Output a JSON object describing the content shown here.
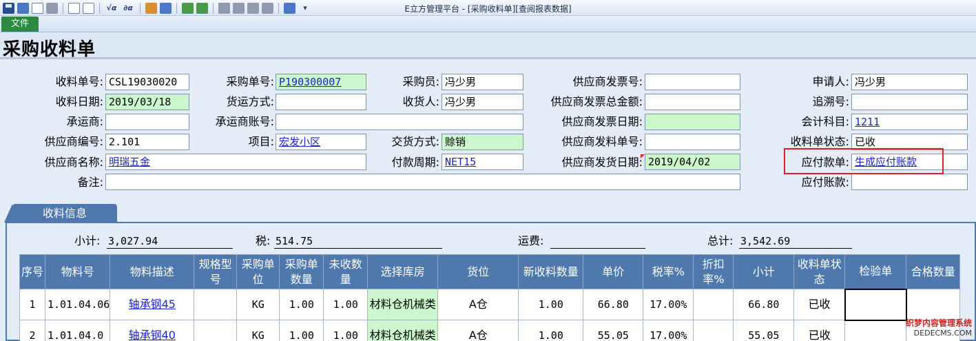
{
  "window": {
    "title": "E立方管理平台 - [采购收料单][查阅报表数据]"
  },
  "ribbon": {
    "file_label": "文件"
  },
  "page": {
    "title": "采购收料单"
  },
  "form": {
    "receipt_no": {
      "label": "收料单号:",
      "value": "CSL19030020"
    },
    "receipt_date": {
      "label": "收料日期:",
      "value": "2019/03/18"
    },
    "carrier": {
      "label": "承运商:",
      "value": ""
    },
    "supplier_code": {
      "label": "供应商编号:",
      "value": "2.101"
    },
    "supplier_name": {
      "label": "供应商名称:",
      "value": "明瑞五金"
    },
    "remark": {
      "label": "备注:",
      "value": ""
    },
    "po_no": {
      "label": "采购单号:",
      "value": "P190300007"
    },
    "ship_method": {
      "label": "货运方式:",
      "value": ""
    },
    "carrier_account": {
      "label": "承运商账号:",
      "value": ""
    },
    "project": {
      "label": "项目:",
      "value": "宏发小区"
    },
    "buyer": {
      "label": "采购员:",
      "value": "冯少男"
    },
    "receiver": {
      "label": "收货人:",
      "value": "冯少男"
    },
    "delivery_method": {
      "label": "交货方式:",
      "value": "赊销"
    },
    "payment_term": {
      "label": "付款周期:",
      "value": "NET15"
    },
    "supplier_invoice_no": {
      "label": "供应商发票号:",
      "value": ""
    },
    "supplier_invoice_total": {
      "label": "供应商发票总金额:",
      "value": ""
    },
    "supplier_invoice_date": {
      "label": "供应商发票日期:",
      "value": ""
    },
    "supplier_ship_no": {
      "label": "供应商发料单号:",
      "value": ""
    },
    "supplier_ship_date": {
      "label": "供应商发货日期:",
      "value": "2019/04/02"
    },
    "applicant": {
      "label": "申请人:",
      "value": "冯少男"
    },
    "trace_no": {
      "label": "追溯号:",
      "value": ""
    },
    "account_subject": {
      "label": "会计科目:",
      "value": "1211"
    },
    "receipt_status": {
      "label": "收料单状态:",
      "value": "已收"
    },
    "payable_doc": {
      "label": "应付款单:",
      "value": "生成应付账款"
    },
    "payable": {
      "label": "应付账款:",
      "value": ""
    }
  },
  "tab": {
    "label": "收料信息"
  },
  "totals": {
    "subtotal": {
      "label": "小计:",
      "value": "3,027.94"
    },
    "tax": {
      "label": "税:",
      "value": "514.75"
    },
    "freight": {
      "label": "运费:",
      "value": ""
    },
    "total": {
      "label": "总计:",
      "value": "3,542.69"
    }
  },
  "grid": {
    "headers": [
      "序号",
      "物料号",
      "物料描述",
      "规格型号",
      "采购单位",
      "采购单数量",
      "未收数量",
      "选择库房",
      "货位",
      "新收料数量",
      "单价",
      "税率%",
      "折扣率%",
      "小计",
      "收料单状态",
      "检验单",
      "合格数量"
    ],
    "rows": [
      [
        "1",
        "1.01.04.06",
        "轴承钢45",
        "",
        "KG",
        "1.00",
        "1.00",
        "材料仓机械类",
        "A仓",
        "1.00",
        "66.80",
        "17.00%",
        "",
        "66.80",
        "已收",
        "",
        ""
      ],
      [
        "2",
        "1.01.04.0",
        "轴承钢40",
        "",
        "KG",
        "1.00",
        "1.00",
        "材料仓机械类",
        "A仓",
        "1.00",
        "55.05",
        "17.00%",
        "",
        "55.05",
        "已收",
        "",
        ""
      ]
    ]
  },
  "watermark": {
    "line1": "织梦内容管理系统",
    "line2": "DEDECMS.COM"
  }
}
